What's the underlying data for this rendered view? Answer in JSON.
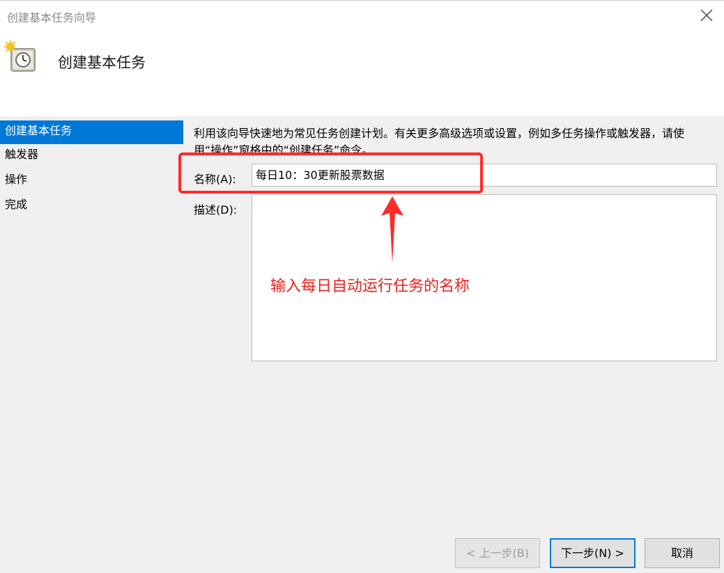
{
  "window": {
    "title": "创建基本任务向导",
    "close_icon": "close-icon"
  },
  "header": {
    "heading": "创建基本任务",
    "icon": "task-scheduler-clock-icon"
  },
  "steps": [
    {
      "label": "创建基本任务",
      "active": true
    },
    {
      "label": "触发器",
      "active": false
    },
    {
      "label": "操作",
      "active": false
    },
    {
      "label": "完成",
      "active": false
    }
  ],
  "main": {
    "intro_text": "利用该向导快速地为常见任务创建计划。有关更多高级选项或设置，例如多任务操作或触发器，请使用“操作”窗格中的“创建任务”命令。",
    "name_label": "名称(A):",
    "name_value": "每日10：30更新股票数据",
    "description_label": "描述(D):",
    "description_value": ""
  },
  "annotation": {
    "text": "输入每日自动运行任务的名称",
    "color": "#e8231f"
  },
  "buttons": {
    "back": "< 上一步(B)",
    "next": "下一步(N) >",
    "cancel": "取消"
  },
  "colors": {
    "accent": "#0078d7",
    "highlight_border": "#ff2a2a"
  }
}
